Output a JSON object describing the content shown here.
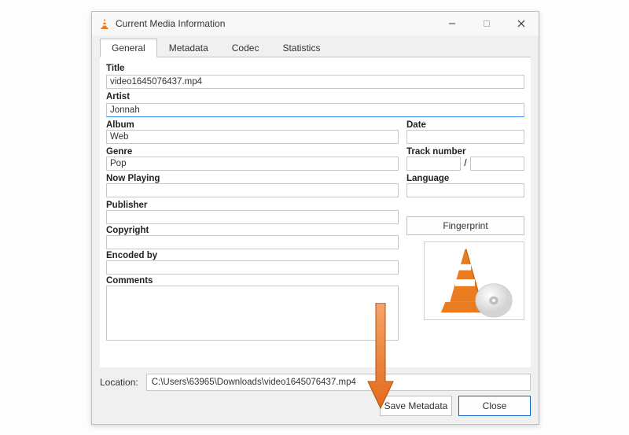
{
  "window": {
    "title": "Current Media Information"
  },
  "tabs": {
    "general": "General",
    "metadata": "Metadata",
    "codec": "Codec",
    "statistics": "Statistics"
  },
  "fields": {
    "title_label": "Title",
    "title_value": "video1645076437.mp4",
    "artist_label": "Artist",
    "artist_value": "Jonnah",
    "album_label": "Album",
    "album_value": "Web",
    "date_label": "Date",
    "date_value": "",
    "genre_label": "Genre",
    "genre_value": "Pop",
    "track_label": "Track number",
    "track_a": "",
    "track_sep": "/",
    "track_b": "",
    "nowplaying_label": "Now Playing",
    "nowplaying_value": "",
    "language_label": "Language",
    "language_value": "",
    "publisher_label": "Publisher",
    "publisher_value": "",
    "copyright_label": "Copyright",
    "copyright_value": "",
    "encodedby_label": "Encoded by",
    "encodedby_value": "",
    "comments_label": "Comments",
    "comments_value": ""
  },
  "buttons": {
    "fingerprint": "Fingerprint",
    "save": "Save Metadata",
    "close": "Close"
  },
  "location": {
    "label": "Location:",
    "value": "C:\\Users\\63965\\Downloads\\video1645076437.mp4"
  }
}
